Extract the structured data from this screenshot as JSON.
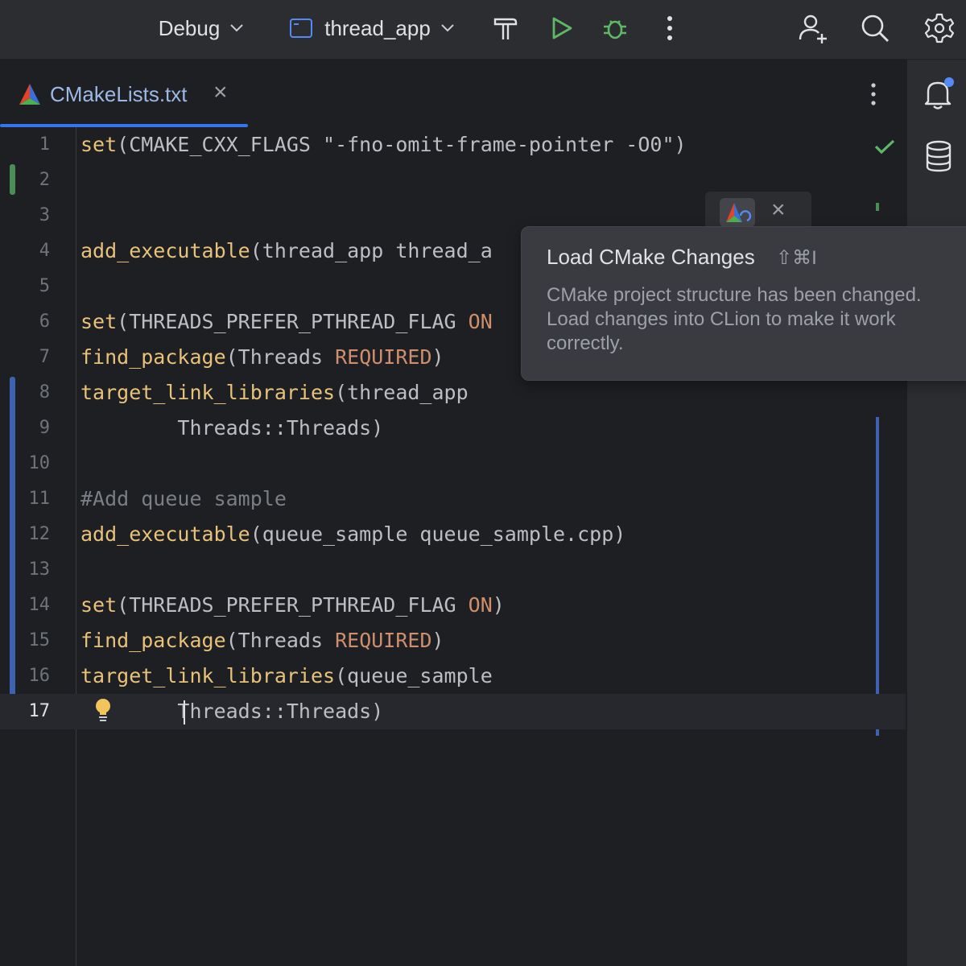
{
  "toolbar": {
    "config_label": "Debug",
    "project_label": "thread_app",
    "icons": [
      "chevron-down-icon",
      "window-icon",
      "hammer-icon",
      "run-icon",
      "debug-icon",
      "more-vertical-icon",
      "add-user-icon",
      "search-icon",
      "gear-icon"
    ],
    "accent_run": "#5fb865",
    "accent_debug": "#5fb865"
  },
  "tab": {
    "label": "CMakeLists.txt",
    "close_symbol": "×",
    "color": "#9cb9e6",
    "underline": "#3574f0"
  },
  "editor": {
    "current_line": 17,
    "lines": [
      {
        "n": "1"
      },
      {
        "n": "2"
      },
      {
        "n": "3"
      },
      {
        "n": "4"
      },
      {
        "n": "5"
      },
      {
        "n": "6"
      },
      {
        "n": "7"
      },
      {
        "n": "8"
      },
      {
        "n": "9"
      },
      {
        "n": "10"
      },
      {
        "n": "11"
      },
      {
        "n": "12"
      },
      {
        "n": "13"
      },
      {
        "n": "14"
      },
      {
        "n": "15"
      },
      {
        "n": "16"
      },
      {
        "n": "17"
      }
    ],
    "tokens": {
      "l1_fn": "set",
      "l1_rest": "(CMAKE_CXX_FLAGS \"-fno-omit-frame-pointer -O0\")",
      "l4_fn": "add_executable",
      "l4_rest": "(thread_app thread_a",
      "l6_fn": "set",
      "l6_rest": "(THREADS_PREFER_PTHREAD_FLAG ",
      "l6_kw": "ON",
      "l7_fn": "find_package",
      "l7_rest": "(Threads ",
      "l7_kw": "REQUIRED",
      "l7_end": ")",
      "l8_fn": "target_link_libraries",
      "l8_rest": "(thread_app",
      "l9_rest": "        Threads::Threads)",
      "l11_cm": "#Add queue sample",
      "l12_fn": "add_executable",
      "l12_rest": "(queue_sample queue_sample.cpp)",
      "l14_fn": "set",
      "l14_rest": "(THREADS_PREFER_PTHREAD_FLAG ",
      "l14_kw": "ON",
      "l14_end": ")",
      "l15_fn": "find_package",
      "l15_rest": "(Threads ",
      "l15_kw": "REQUIRED",
      "l15_end": ")",
      "l16_fn": "target_link_libraries",
      "l16_rest": "(queue_sample",
      "l17_rest": "        Threads::Threads)"
    },
    "colors": {
      "function": "#e8c17a",
      "keyword": "#cf8e6d",
      "comment": "#7a7e85",
      "text": "#bcbec4",
      "added": "#4a8e57",
      "modified": "#3d63b0"
    }
  },
  "popup": {
    "title": "Load CMake Changes",
    "shortcut": "⇧⌘I",
    "body": "CMake project structure has been changed. Load changes into CLion to make it work correctly."
  },
  "floating": {
    "close_symbol": "×"
  },
  "right_strip": {
    "icons": [
      "bell-icon",
      "database-icon"
    ],
    "badge_color": "#3574f0"
  }
}
